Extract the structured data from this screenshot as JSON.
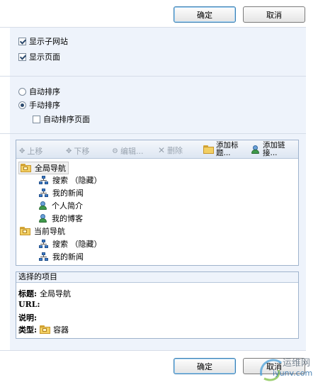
{
  "top_buttons": {
    "ok": "确定",
    "cancel": "取消"
  },
  "display": {
    "show_subsites": {
      "label": "显示子网站",
      "checked": true
    },
    "show_pages": {
      "label": "显示页面",
      "checked": true
    }
  },
  "sorting": {
    "auto": {
      "label": "自动排序",
      "selected": false
    },
    "manual": {
      "label": "手动排序",
      "selected": true
    },
    "auto_pages": {
      "label": "自动排序页面",
      "checked": false
    }
  },
  "toolbar": {
    "move_up": "上移",
    "move_down": "下移",
    "edit": "编辑...",
    "delete": "删除",
    "add_heading": [
      "添加标",
      "题..."
    ],
    "add_link": [
      "添加链",
      "接..."
    ]
  },
  "tree": {
    "global": {
      "label": "全局导航",
      "children": [
        {
          "label": "搜索 （隐藏）",
          "icon": "sitemap-icon"
        },
        {
          "label": "我的新闻",
          "icon": "sitemap-icon"
        },
        {
          "label": "个人简介",
          "icon": "person-icon"
        },
        {
          "label": "我的博客",
          "icon": "person-icon"
        }
      ]
    },
    "current": {
      "label": "当前导航",
      "children": [
        {
          "label": "搜索 （隐藏）",
          "icon": "sitemap-icon"
        },
        {
          "label": "我的新闻",
          "icon": "sitemap-icon"
        }
      ]
    }
  },
  "selected_item": {
    "header": "选择的项目",
    "title_key": "标题:",
    "title_val": "全局导航",
    "url_key": "URL:",
    "url_val": "",
    "desc_key": "说明:",
    "desc_val": "",
    "type_key": "类型:",
    "type_val": "容器"
  },
  "bottom_buttons": {
    "ok": "确定",
    "cancel": "取消"
  },
  "watermark": {
    "line1": "运维网",
    "line2": "iyunv.com"
  }
}
